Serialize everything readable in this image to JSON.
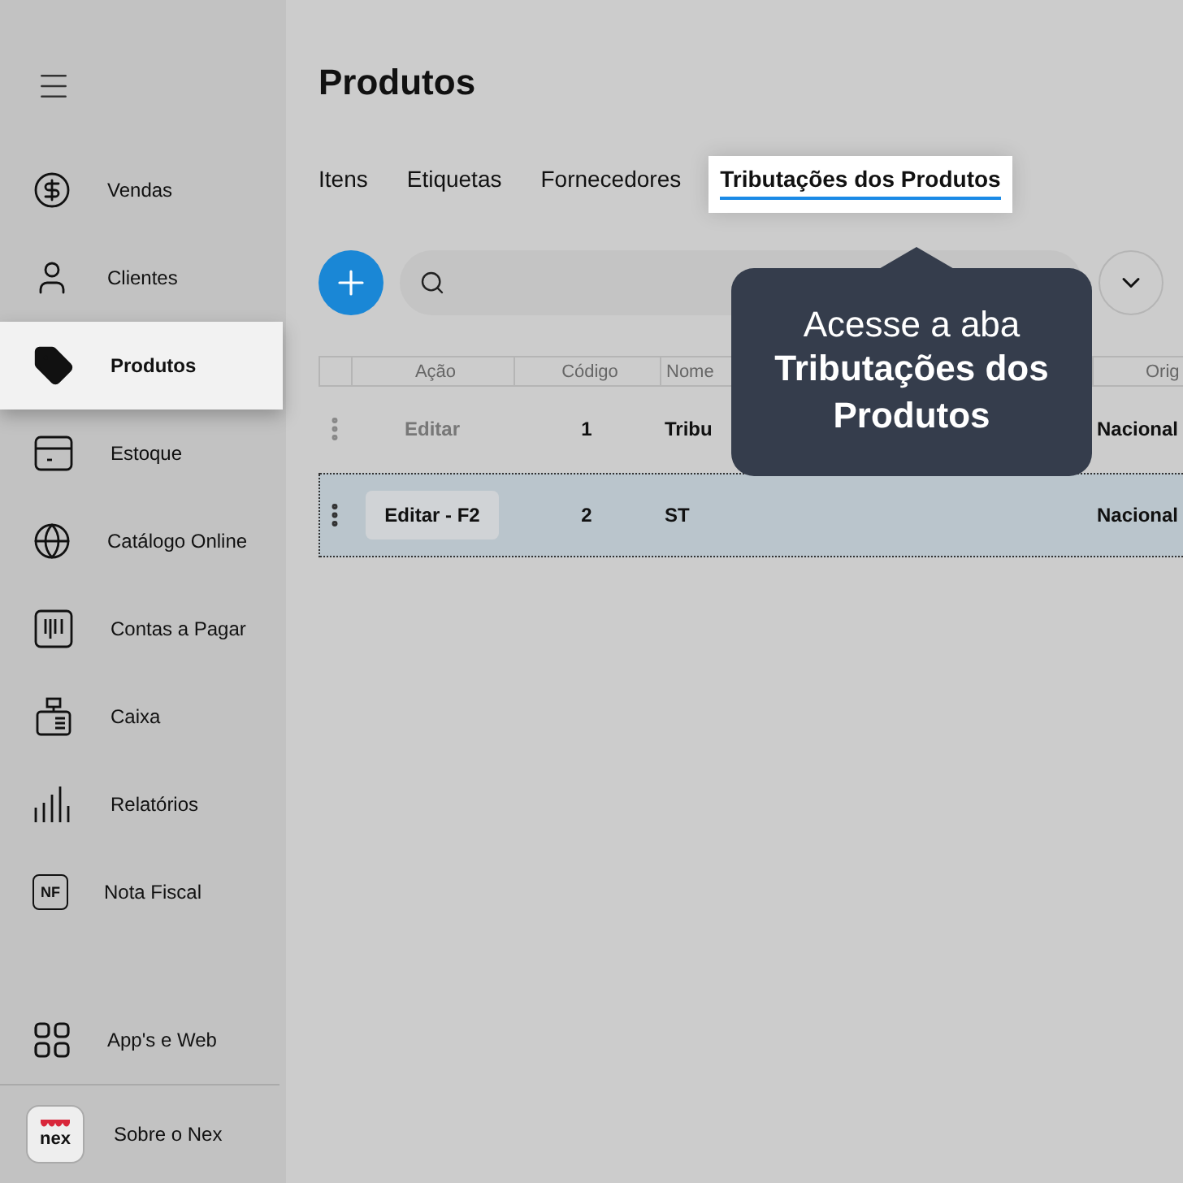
{
  "sidebar": {
    "items": [
      {
        "label": "Vendas",
        "selected": false
      },
      {
        "label": "Clientes",
        "selected": false
      },
      {
        "label": "Produtos",
        "selected": true
      },
      {
        "label": "Estoque",
        "selected": false
      },
      {
        "label": "Catálogo Online",
        "selected": false
      },
      {
        "label": "Contas a Pagar",
        "selected": false
      },
      {
        "label": "Caixa",
        "selected": false
      },
      {
        "label": "Relatórios",
        "selected": false
      },
      {
        "label": "Nota Fiscal",
        "selected": false,
        "badge": "NF"
      }
    ],
    "bottom_item": {
      "label": "App's e Web"
    },
    "about": {
      "label": "Sobre o Nex",
      "logo_text": "nex"
    }
  },
  "page": {
    "title": "Produtos"
  },
  "tabs": [
    {
      "label": "Itens",
      "selected": false
    },
    {
      "label": "Etiquetas",
      "selected": false
    },
    {
      "label": "Fornecedores",
      "selected": false
    },
    {
      "label": "Tributações dos Produtos",
      "selected": true
    }
  ],
  "table": {
    "columns": [
      "Ação",
      "Código",
      "Nome",
      "Orig"
    ],
    "rows": [
      {
        "action": "Editar",
        "code": "1",
        "name": "Tribu",
        "origin": "Nacional",
        "selected": false
      },
      {
        "action": "Editar - F2",
        "code": "2",
        "name": "ST",
        "origin": "Nacional",
        "selected": true
      }
    ]
  },
  "tooltip": {
    "line1": "Acesse a aba",
    "line2": "Tributações dos Produtos"
  }
}
